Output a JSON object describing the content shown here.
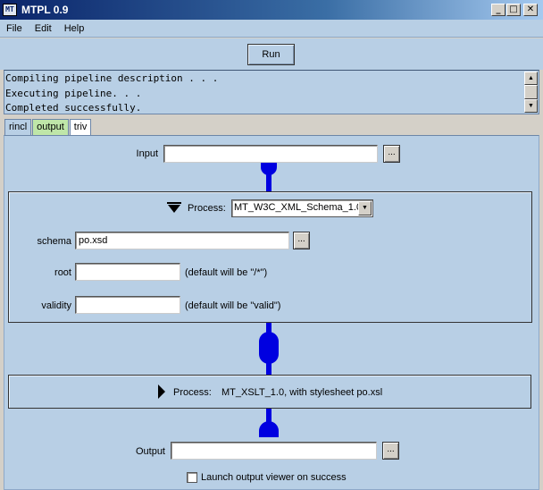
{
  "window": {
    "title": "MTPL 0.9",
    "icon_text": "MT",
    "minimize_glyph": "_",
    "maximize_glyph": "□",
    "close_glyph": "✕"
  },
  "menu": {
    "items": [
      "File",
      "Edit",
      "Help"
    ]
  },
  "toolbar": {
    "run_label": "Run"
  },
  "console": {
    "lines": [
      "Compiling pipeline description . . .",
      "Executing pipeline. . .",
      "Completed successfully."
    ],
    "scroll_up_glyph": "▲",
    "scroll_down_glyph": "▼"
  },
  "tabs": [
    {
      "label": "rincl",
      "active": false,
      "color": "#b8cfe5"
    },
    {
      "label": "output",
      "active": false,
      "color": "#bfe6a8"
    },
    {
      "label": "triv",
      "active": true,
      "color": "#ffffff"
    }
  ],
  "pipeline": {
    "input": {
      "label": "Input",
      "value": "",
      "browse_label": "..."
    },
    "process1": {
      "label": "Process:",
      "selected": "MT_W3C_XML_Schema_1.0",
      "fields": [
        {
          "label": "schema",
          "value": "po.xsd",
          "browse_label": "...",
          "hint": ""
        },
        {
          "label": "root",
          "value": "",
          "hint": "(default will be \"/*\")"
        },
        {
          "label": "validity",
          "value": "",
          "hint": "(default will be \"valid\")"
        }
      ]
    },
    "process2": {
      "label": "Process:",
      "description": "MT_XSLT_1.0, with stylesheet po.xsl"
    },
    "output": {
      "label": "Output",
      "value": "",
      "browse_label": "..."
    },
    "launch_viewer": {
      "label": "Launch output viewer on success",
      "checked": false
    }
  },
  "colors": {
    "panel": "#b8cfe5",
    "connector": "#0000e0",
    "titlebar": "#0a246a"
  }
}
